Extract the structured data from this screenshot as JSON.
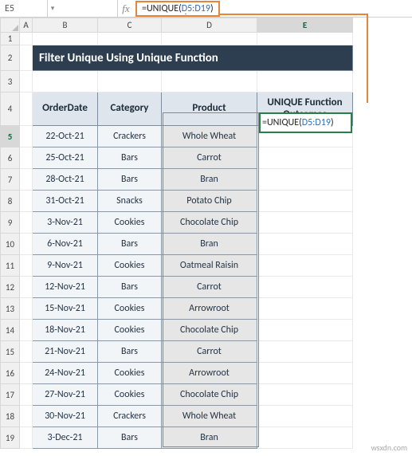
{
  "namebox": "E5",
  "formula": {
    "prefix": "=UNIQUE(",
    "ref": "D5:D19",
    "suffix": ")"
  },
  "columns": [
    "A",
    "B",
    "C",
    "D",
    "E"
  ],
  "rows": [
    "1",
    "2",
    "3",
    "4",
    "5",
    "6",
    "7",
    "8",
    "9",
    "10",
    "11",
    "12",
    "13",
    "14",
    "15",
    "16",
    "17",
    "18",
    "19"
  ],
  "title": "Filter Unique Using Unique Function",
  "headers": {
    "orderDate": "OrderDate",
    "category": "Category",
    "product": "Product",
    "outcomes_l1": "UNIQUE Function",
    "outcomes_l2": "Outcomes"
  },
  "data": [
    {
      "date": "22-Oct-21",
      "cat": "Crackers",
      "prod": "Whole Wheat"
    },
    {
      "date": "25-Oct-21",
      "cat": "Bars",
      "prod": "Carrot"
    },
    {
      "date": "28-Oct-21",
      "cat": "Bars",
      "prod": "Bran"
    },
    {
      "date": "31-Oct-21",
      "cat": "Snacks",
      "prod": "Potato Chip"
    },
    {
      "date": "3-Nov-21",
      "cat": "Cookies",
      "prod": "Chocolate Chip"
    },
    {
      "date": "6-Nov-21",
      "cat": "Bars",
      "prod": "Bran"
    },
    {
      "date": "9-Nov-21",
      "cat": "Cookies",
      "prod": "Oatmeal Raisin"
    },
    {
      "date": "12-Nov-21",
      "cat": "Bars",
      "prod": "Carrot"
    },
    {
      "date": "15-Nov-21",
      "cat": "Cookies",
      "prod": "Arrowroot"
    },
    {
      "date": "18-Nov-21",
      "cat": "Cookies",
      "prod": "Chocolate Chip"
    },
    {
      "date": "21-Nov-21",
      "cat": "Bars",
      "prod": "Carrot"
    },
    {
      "date": "24-Nov-21",
      "cat": "Cookies",
      "prod": "Arrowroot"
    },
    {
      "date": "27-Nov-21",
      "cat": "Cookies",
      "prod": "Chocolate Chip"
    },
    {
      "date": "30-Nov-21",
      "cat": "Crackers",
      "prod": "Whole Wheat"
    },
    {
      "date": "3-Dec-21",
      "cat": "Bars",
      "prod": "Bran"
    }
  ],
  "active_formula": {
    "prefix": "=UNIQUE(",
    "ref": "D5:D19",
    "suffix": ")"
  },
  "watermark": "wsxdn.com"
}
